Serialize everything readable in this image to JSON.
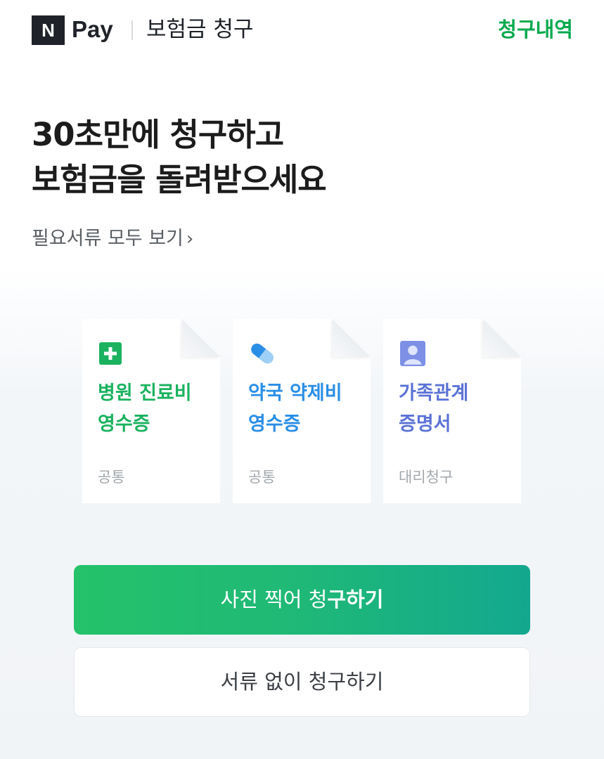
{
  "header": {
    "logo_letter": "N",
    "brand": "Pay",
    "title": "보험금 청구",
    "history_link": "청구내역",
    "accent_color": "#03a94d"
  },
  "hero": {
    "line1": "30초만에 청구하고",
    "line2": "보험금을 돌려받으세요",
    "docs_link": "필요서류 모두 보기",
    "docs_chevron": "›"
  },
  "cards": [
    {
      "icon": "hospital-plus-icon",
      "title_line1": "병원 진료비",
      "title_line2": "영수증",
      "tag": "공통",
      "color": "#1bb25f"
    },
    {
      "icon": "pill-capsule-icon",
      "title_line1": "약국 약제비",
      "title_line2": "영수증",
      "tag": "공통",
      "color": "#2a8ee6"
    },
    {
      "icon": "person-id-icon",
      "title_line1": "가족관계",
      "title_line2": "증명서",
      "tag": "대리청구",
      "color": "#5b72d6"
    }
  ],
  "actions": {
    "photo_claim_normal": "사진 찍어 청",
    "photo_claim_bold": "구하기",
    "no_docs_claim": "서류 없이 청구하기"
  }
}
